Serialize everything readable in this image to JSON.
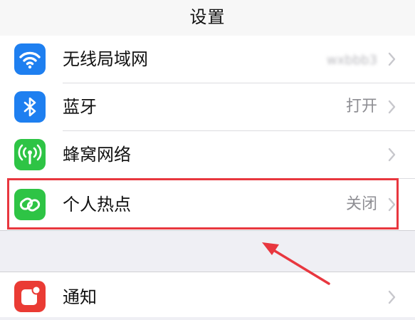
{
  "navbar": {
    "title": "设置"
  },
  "groups": [
    {
      "items": [
        {
          "label": "无线局域网",
          "value": "wxbbb3",
          "value_blurred": true,
          "icon": "wifi-icon",
          "icon_color": "#1e7ff0"
        },
        {
          "label": "蓝牙",
          "value": "打开",
          "icon": "bluetooth-icon",
          "icon_color": "#1e7ff0"
        },
        {
          "label": "蜂窝网络",
          "value": "",
          "icon": "cellular-icon",
          "icon_color": "#2ec445"
        },
        {
          "label": "个人热点",
          "value": "关闭",
          "icon": "hotspot-icon",
          "icon_color": "#2ec445",
          "highlighted": true
        }
      ]
    },
    {
      "items": [
        {
          "label": "通知",
          "value": "",
          "icon": "notifications-icon",
          "icon_color": "#ea3b34"
        }
      ]
    }
  ],
  "annotation": {
    "color": "#e8373f",
    "target": "个人热点"
  }
}
